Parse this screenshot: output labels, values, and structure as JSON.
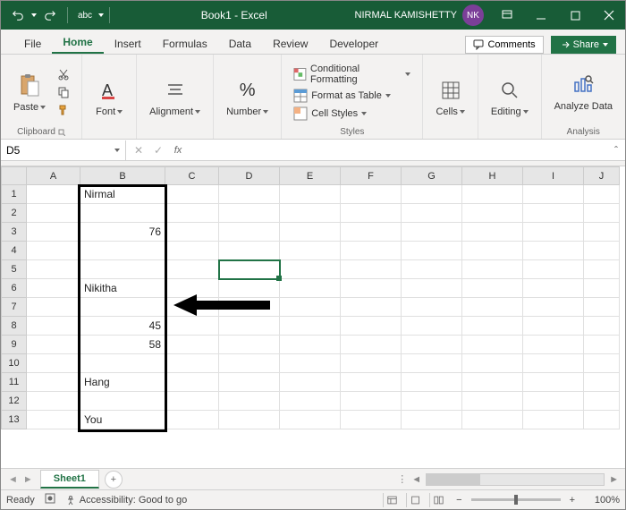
{
  "title": "Book1 - Excel",
  "user": {
    "name": "NIRMAL KAMISHETTY",
    "initials": "NK"
  },
  "tabs": {
    "file": "File",
    "home": "Home",
    "insert": "Insert",
    "formulas": "Formulas",
    "data": "Data",
    "review": "Review",
    "developer": "Developer"
  },
  "commands": {
    "comments": "Comments",
    "share": "Share"
  },
  "ribbon": {
    "clipboard": {
      "paste": "Paste",
      "label": "Clipboard"
    },
    "font": {
      "btn": "Font"
    },
    "alignment": {
      "btn": "Alignment"
    },
    "number": {
      "btn": "Number"
    },
    "styles": {
      "cond": "Conditional Formatting",
      "table": "Format as Table",
      "cellstyles": "Cell Styles",
      "label": "Styles"
    },
    "cells": {
      "btn": "Cells"
    },
    "editing": {
      "btn": "Editing"
    },
    "analysis": {
      "btn": "Analyze Data",
      "label": "Analysis"
    }
  },
  "nameBox": "D5",
  "columns": [
    "A",
    "B",
    "C",
    "D",
    "E",
    "F",
    "G",
    "H",
    "I",
    "J"
  ],
  "rows": [
    "1",
    "2",
    "3",
    "4",
    "5",
    "6",
    "7",
    "8",
    "9",
    "10",
    "11",
    "12",
    "13"
  ],
  "cells": {
    "B1": "Nirmal",
    "B3": "76",
    "B6": "Nikitha",
    "B8": "45",
    "B9": "58",
    "B11": "Hang",
    "B13": "You"
  },
  "sheet": {
    "name": "Sheet1"
  },
  "status": {
    "ready": "Ready",
    "accessibility": "Accessibility: Good to go",
    "zoom": "100%"
  },
  "colWidths": {
    "rowhead": 28,
    "A": 60,
    "B": 95,
    "C": 60,
    "D": 68,
    "E": 68,
    "F": 68,
    "G": 68,
    "H": 68,
    "I": 68,
    "J": 40
  }
}
